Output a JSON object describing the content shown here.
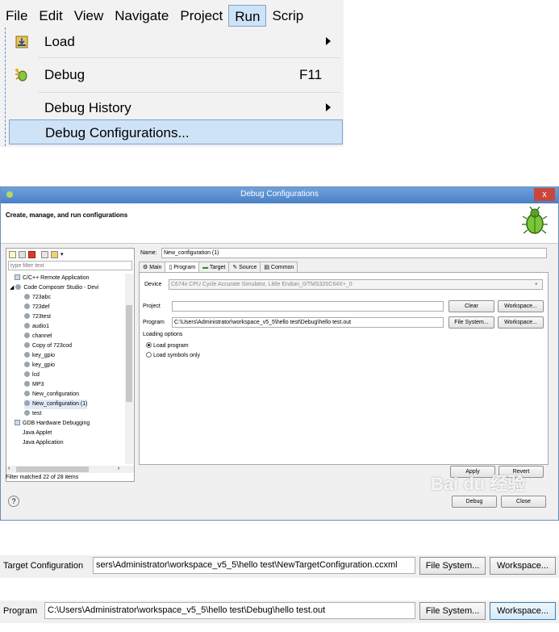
{
  "menubar": {
    "items": [
      "File",
      "Edit",
      "View",
      "Navigate",
      "Project",
      "Run",
      "Scrip"
    ],
    "active": "Run"
  },
  "run_menu": {
    "items": [
      {
        "label": "Load",
        "accelerator": "",
        "submenu": true,
        "icon": "load-icon"
      },
      {
        "label": "Debug",
        "accelerator": "F11",
        "submenu": false,
        "icon": "debug-icon"
      },
      {
        "label": "Debug History",
        "accelerator": "",
        "submenu": true,
        "icon": ""
      },
      {
        "label": "Debug Configurations...",
        "accelerator": "",
        "submenu": false,
        "icon": "",
        "highlighted": true
      }
    ]
  },
  "dialog": {
    "title": "Debug Configurations",
    "close_glyph": "x",
    "header": "Create, manage, and run configurations",
    "filter_placeholder": "type filter text",
    "tree": [
      {
        "label": "C/C++ Remote Application",
        "level": 1
      },
      {
        "label": "Code Composer Studio - Devi",
        "level": 1,
        "expanded": true
      },
      {
        "label": "723abc",
        "level": 2
      },
      {
        "label": "723def",
        "level": 2
      },
      {
        "label": "723test",
        "level": 2
      },
      {
        "label": "audio1",
        "level": 2
      },
      {
        "label": "channel",
        "level": 2
      },
      {
        "label": "Copy of 723cod",
        "level": 2
      },
      {
        "label": "key_gpio",
        "level": 2
      },
      {
        "label": "key_gpio",
        "level": 2
      },
      {
        "label": "lcd",
        "level": 2
      },
      {
        "label": "MP3",
        "level": 2
      },
      {
        "label": "New_configuration",
        "level": 2
      },
      {
        "label": "New_configuration (1)",
        "level": 2,
        "selected": true
      },
      {
        "label": "test",
        "level": 2
      },
      {
        "label": "GDB Hardware Debugging",
        "level": 1
      },
      {
        "label": "Java Applet",
        "level": 1
      },
      {
        "label": "Java Application",
        "level": 1
      }
    ],
    "filter_status": "Filter matched 22 of 28 items",
    "name_label": "Name:",
    "name_value": "New_configuration (1)",
    "tabs": [
      "Main",
      "Program",
      "Target",
      "Source",
      "Common"
    ],
    "active_tab": "Program",
    "device_label": "Device",
    "device_value": "C674x CPU Cycle Accurate Simulator, Little Endian_0/TMS320C64X+_0",
    "project_label": "Project",
    "project_value": "",
    "program_label": "Program",
    "program_value": "C:\\Users\\Administrator\\workspace_v5_5\\hello test\\Debug\\hello test.out",
    "clear_btn": "Clear",
    "workspace_btn": "Workspace...",
    "filesystem_btn": "File System...",
    "loading_options": "Loading options",
    "load_program": "Load program",
    "load_symbols": "Load symbols only",
    "apply_btn": "Apply",
    "revert_btn": "Revert",
    "debug_btn": "Debug",
    "close_btn": "Close",
    "help_glyph": "?"
  },
  "target_row": {
    "label": "Target Configuration",
    "value": "sers\\Administrator\\workspace_v5_5\\hello test\\NewTargetConfiguration.ccxml",
    "filesystem_btn": "File System...",
    "workspace_btn": "Workspace..."
  },
  "program_row": {
    "label": "Program",
    "value": "C:\\Users\\Administrator\\workspace_v5_5\\hello test\\Debug\\hello test.out",
    "filesystem_btn": "File System...",
    "workspace_btn": "Workspace..."
  }
}
